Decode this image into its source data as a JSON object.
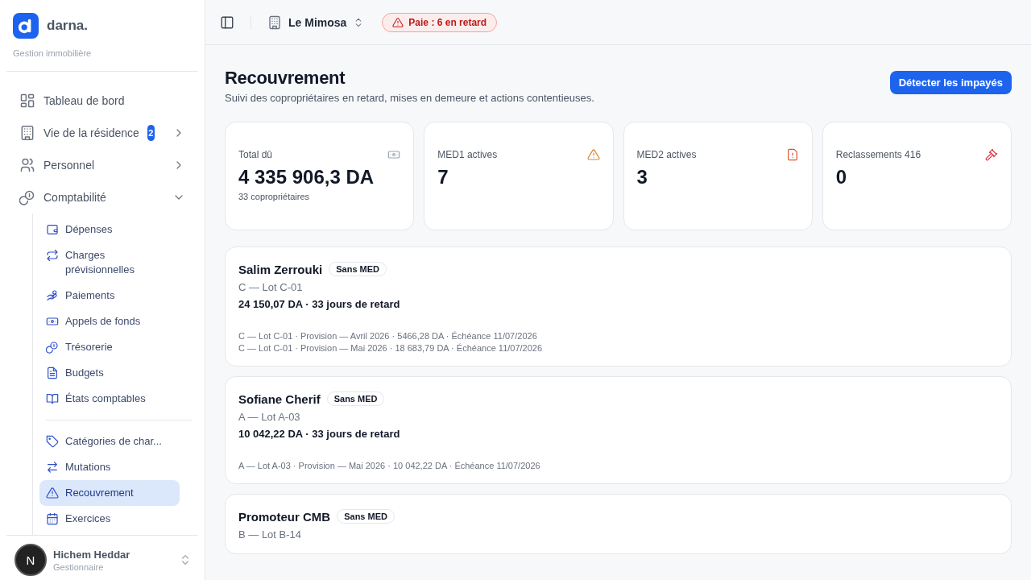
{
  "sidebar": {
    "brand": "darna.",
    "tagline": "Gestion immobilière",
    "nav": [
      {
        "label": "Tableau de bord"
      },
      {
        "label": "Vie de la résidence",
        "badge": "2",
        "expanded": false
      },
      {
        "label": "Personnel",
        "expanded": false
      },
      {
        "label": "Comptabilité",
        "expanded": true,
        "groups": [
          {
            "children": [
              {
                "label": "Dépenses",
                "selected": false
              },
              {
                "label": "Charges prévisionnelles",
                "selected": false
              },
              {
                "label": "Paiements",
                "selected": false
              },
              {
                "label": "Appels de fonds",
                "selected": false
              },
              {
                "label": "Trésorerie",
                "selected": false
              },
              {
                "label": "Budgets",
                "selected": false
              },
              {
                "label": "États comptables",
                "selected": false
              }
            ]
          },
          {
            "children": [
              {
                "label": "Catégories de char...",
                "selected": false
              },
              {
                "label": "Mutations",
                "selected": false
              },
              {
                "label": "Recouvrement",
                "selected": true
              },
              {
                "label": "Exercices",
                "selected": false
              }
            ]
          }
        ]
      }
    ],
    "user": {
      "initial": "N",
      "name": "Hichem Heddar",
      "role": "Gestionnaire"
    }
  },
  "header": {
    "residence": "Le Mimosa",
    "alert": "Paie : 6 en retard"
  },
  "page": {
    "title": "Recouvrement",
    "subtitle": "Suivi des copropriétaires en retard, mises en demeure et actions contentieuses.",
    "action": "Détecter les impayés"
  },
  "stats": [
    {
      "label": "Total dû",
      "value": "4 335 906,3 DA",
      "sub": "33 copropriétaires"
    },
    {
      "label": "MED1 actives",
      "value": "7"
    },
    {
      "label": "MED2 actives",
      "value": "3"
    },
    {
      "label": "Reclassements 416",
      "value": "0"
    }
  ],
  "debtors": [
    {
      "name": "Salim Zerrouki",
      "status": "Sans MED",
      "lot": "C — Lot C-01",
      "summary": "24 150,07 DA · 33 jours de retard",
      "lines": [
        "C — Lot C-01 · Provision — Avril 2026 · 5466,28 DA · Échéance 11/07/2026",
        "C — Lot C-01 · Provision — Mai 2026 · 18 683,79 DA · Échéance 11/07/2026"
      ]
    },
    {
      "name": "Sofiane Cherif",
      "status": "Sans MED",
      "lot": "A — Lot A-03",
      "summary": "10 042,22 DA · 33 jours de retard",
      "lines": [
        "A — Lot A-03 · Provision — Mai 2026 · 10 042,22 DA · Échéance 11/07/2026"
      ]
    },
    {
      "name": "Promoteur CMB",
      "status": "Sans MED",
      "lot": "B — Lot B-14"
    }
  ]
}
